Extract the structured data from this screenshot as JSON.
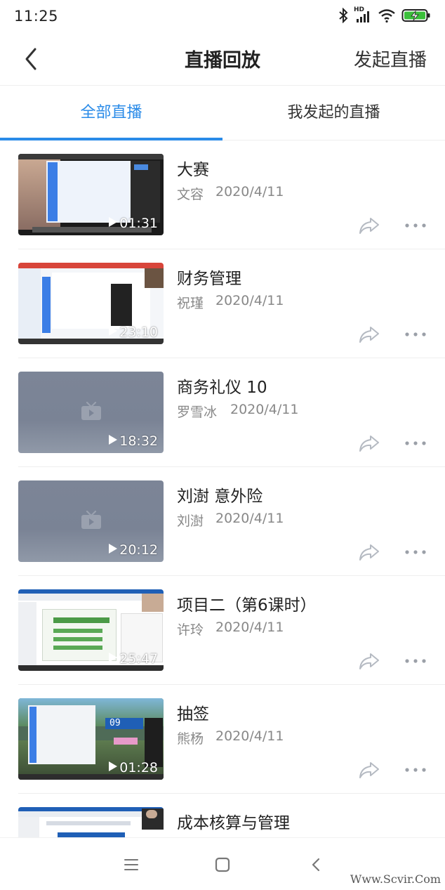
{
  "status_bar": {
    "time": "11:25",
    "hd_label": "HD"
  },
  "header": {
    "title": "直播回放",
    "action_label": "发起直播"
  },
  "tabs": [
    {
      "label": "全部直播",
      "active": true
    },
    {
      "label": "我发起的直播",
      "active": false
    }
  ],
  "items": [
    {
      "title": "大赛",
      "author": "文容",
      "date": "2020/4/11",
      "duration": "01:31",
      "thumb": "screen-a"
    },
    {
      "title": "财务管理",
      "author": "祝瑾",
      "date": "2020/4/11",
      "duration": "23:10",
      "thumb": "screen-b"
    },
    {
      "title": "商务礼仪 10",
      "author": "罗雪冰",
      "date": "2020/4/11",
      "duration": "18:32",
      "thumb": "placeholder"
    },
    {
      "title": "刘澍 意外险",
      "author": "刘澍",
      "date": "2020/4/11",
      "duration": "20:12",
      "thumb": "placeholder"
    },
    {
      "title": "项目二（第6课时）",
      "author": "许玲",
      "date": "2020/4/11",
      "duration": "25:47",
      "thumb": "screen-c"
    },
    {
      "title": "抽签",
      "author": "熊杨",
      "date": "2020/4/11",
      "duration": "01:28",
      "thumb": "screen-d",
      "overlay_number": "09"
    },
    {
      "title": "成本核算与管理",
      "thumb": "screen-c"
    }
  ],
  "watermark": "Www.Scvir.Com",
  "colors": {
    "accent": "#2a8be8",
    "text": "#222222",
    "meta": "#888888",
    "placeholder": "#7c8597"
  }
}
